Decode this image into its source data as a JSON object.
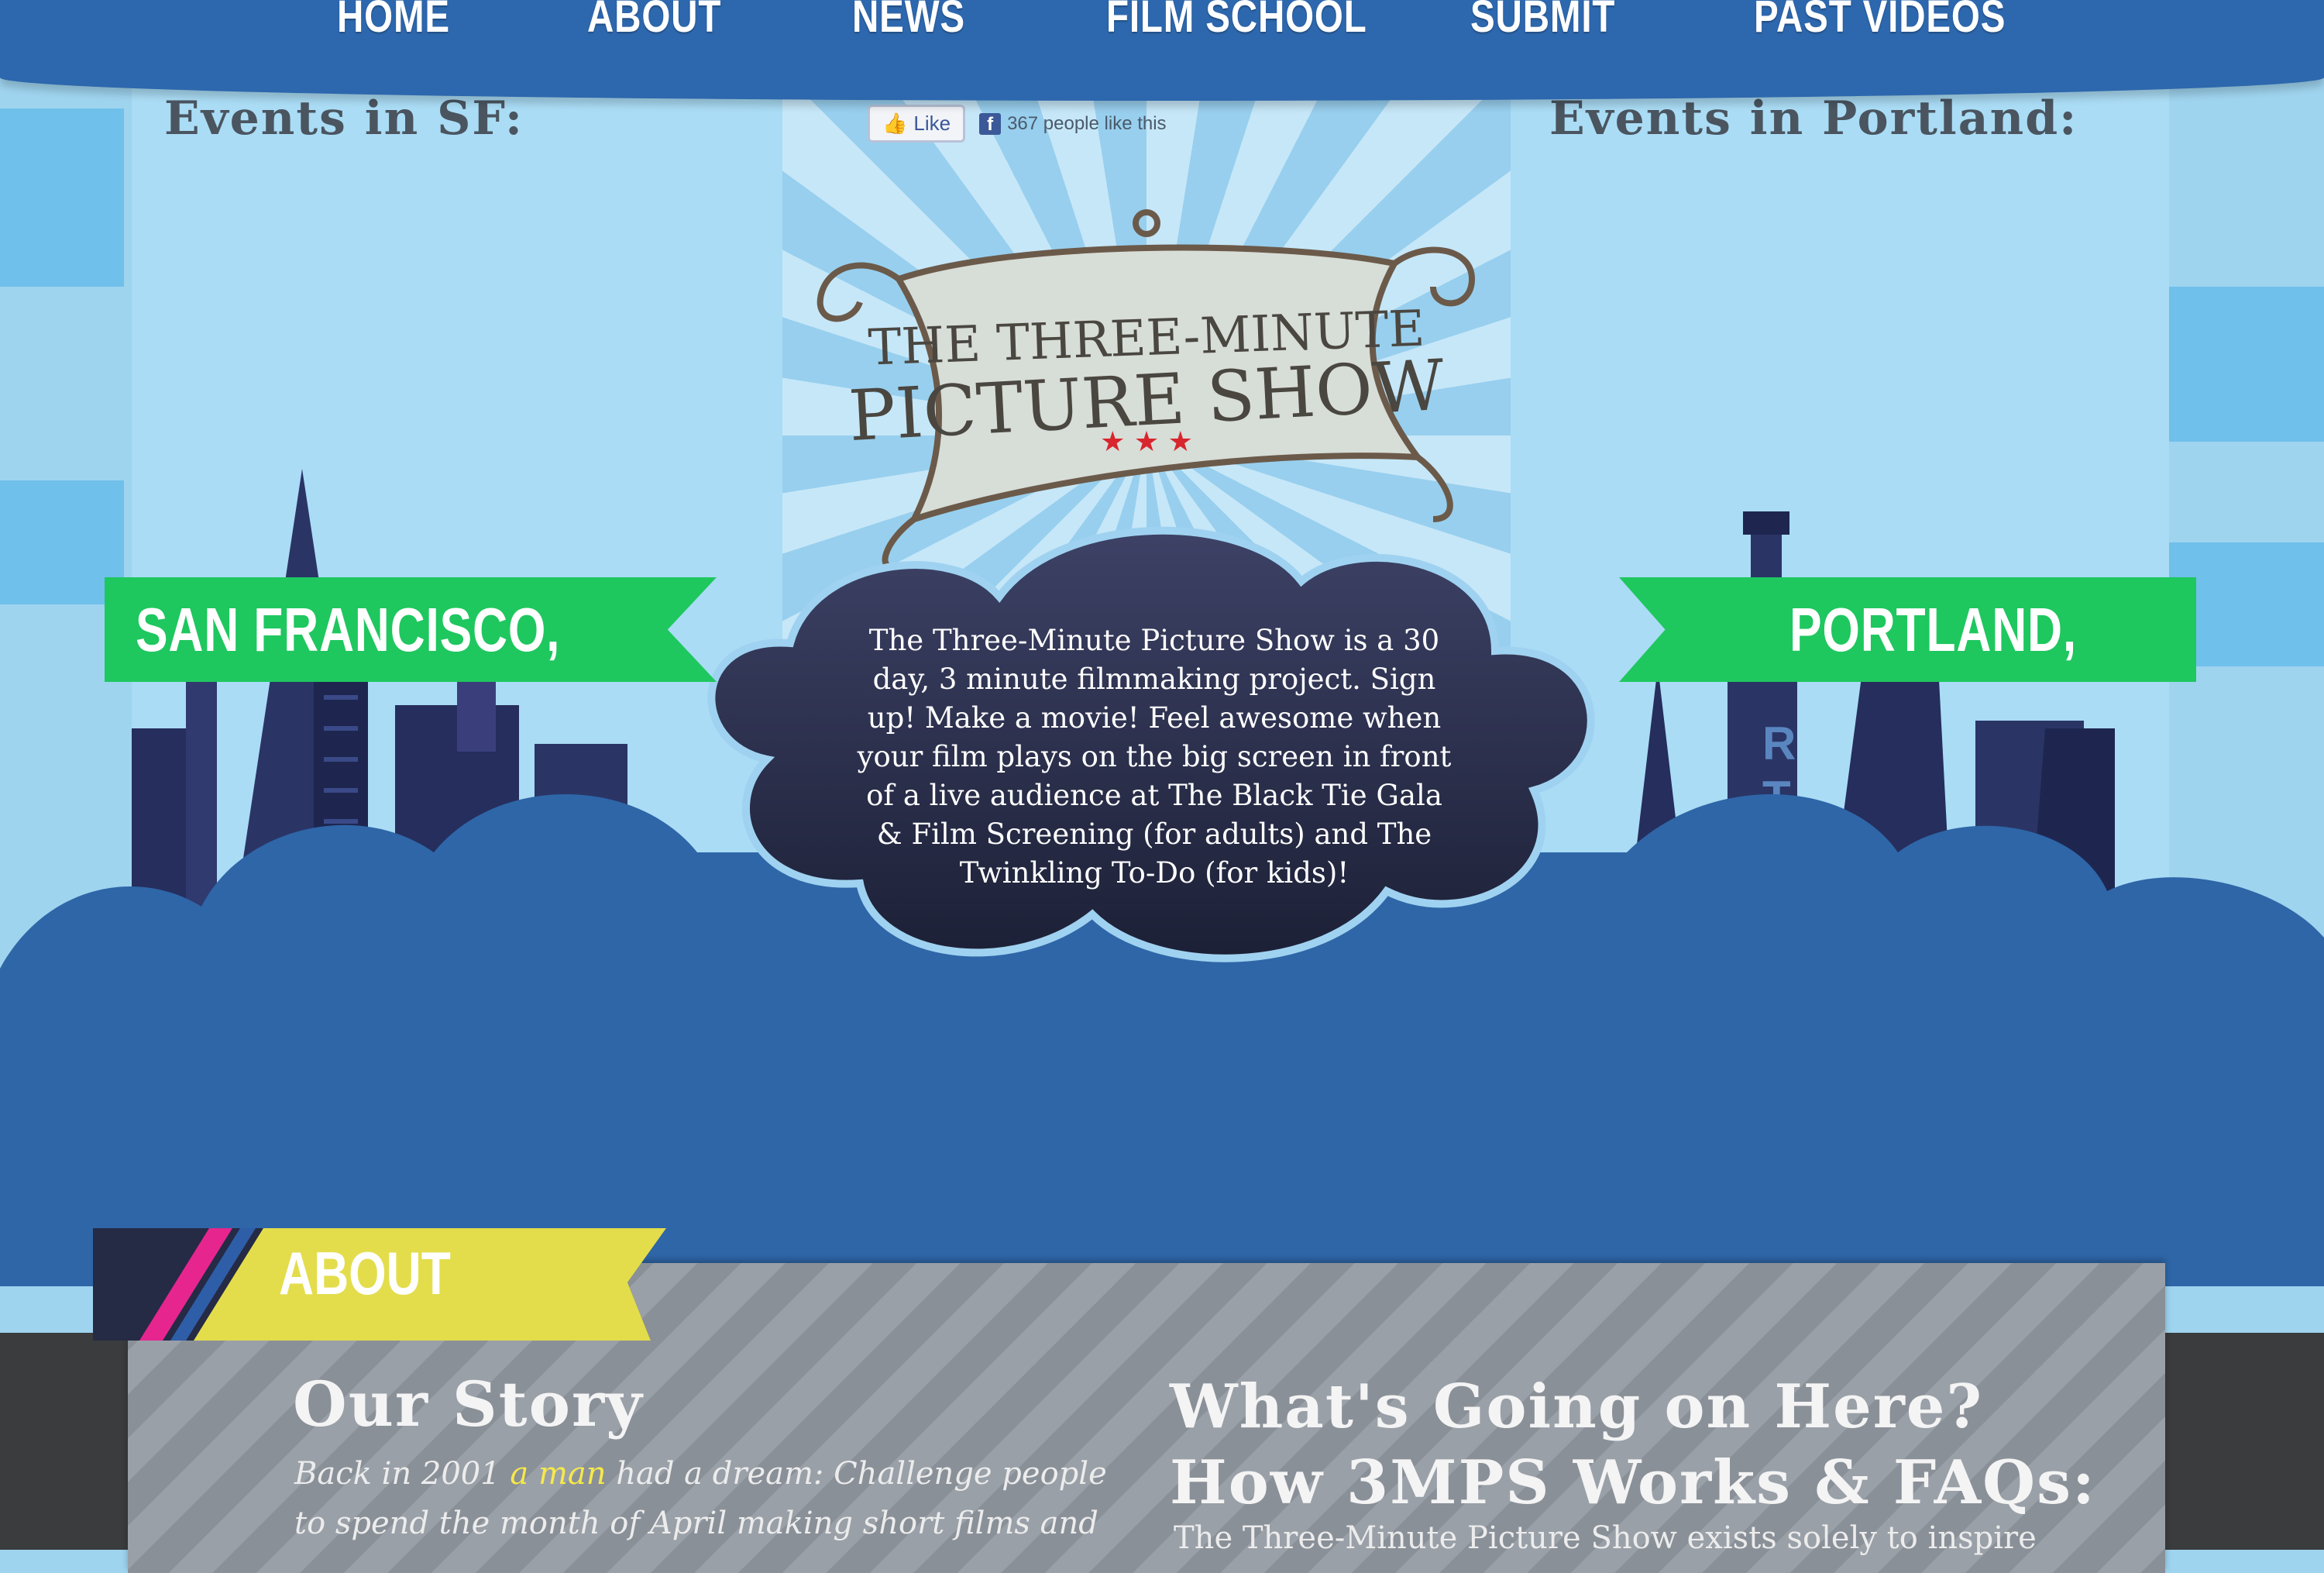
{
  "nav": {
    "items": [
      "HOME",
      "ABOUT",
      "NEWS",
      "FILM SCHOOL",
      "SUBMIT",
      "PAST VIDEOS"
    ]
  },
  "events": {
    "sf_heading": "Events in SF:",
    "portland_heading": "Events in Portland:"
  },
  "facebook": {
    "like_label": "Like",
    "like_count_text": "367 people like this"
  },
  "logo": {
    "line1": "THE THREE-MINUTE",
    "line2": "PICTURE SHOW",
    "stars": "★ ★ ★"
  },
  "intro": {
    "text": "The Three-Minute Picture Show is a 30 day, 3 minute filmmaking project. Sign up! Make a movie! Feel awesome when your film plays on the big screen in front of a live audience at The Black Tie Gala & Film Screening (for adults) and The Twinkling To-Do (for kids)!"
  },
  "cities": {
    "left": "SAN FRANCISCO, CA",
    "right": "PORTLAND, OR"
  },
  "about": {
    "banner_label": "ABOUT",
    "story_heading": "Our Story",
    "story_text_before": "Back in 2001",
    "story_link": "a man",
    "story_text_after": "had  a dream: Challenge people to spend the month of April making short films and",
    "faq_heading_line1": "What's Going on Here?",
    "faq_heading_line2": "How 3MPS Works & FAQs:",
    "faq_text": "The Three-Minute Picture Show exists solely to inspire"
  },
  "colors": {
    "nav_blue": "#2d67ad",
    "sky_light": "#aadcf5",
    "ribbon_green": "#1fc75f",
    "cloud_blue": "#2e66a8",
    "dark_cloud": "#2a2f47",
    "banner_yellow": "#e3dd4c",
    "banner_pink": "#e6258f",
    "link_yellow": "#f6e94a"
  }
}
